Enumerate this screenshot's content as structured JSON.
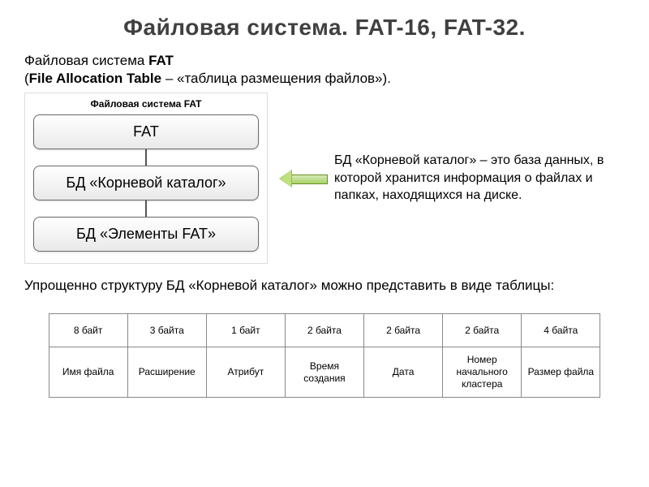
{
  "title": "Файловая система. FAT-16, FAT-32.",
  "intro": {
    "line1_prefix": "Файловая система ",
    "line1_bold": "FAT",
    "line2_open": "(",
    "line2_bold": "File Allocation Table",
    "line2_rest": " – «таблица размещения файлов»)."
  },
  "diagram": {
    "caption": "Файловая система FAT",
    "box1": "FAT",
    "box2": "БД «Корневой каталог»",
    "box3": "БД «Элементы FAT»"
  },
  "callout": "БД «Корневой каталог» – это база данных, в которой хранится информация о файлах и папках, находящихся на диске.",
  "post": "Упрощенно структуру БД «Корневой каталог» можно представить в виде таблицы:",
  "table": {
    "sizes": [
      "8 байт",
      "3 байта",
      "1 байт",
      "2 байта",
      "2 байта",
      "2 байта",
      "4 байта"
    ],
    "fields": [
      "Имя файла",
      "Расширение",
      "Атрибут",
      "Время создания",
      "Дата",
      "Номер начального кластера",
      "Размер файла"
    ]
  }
}
